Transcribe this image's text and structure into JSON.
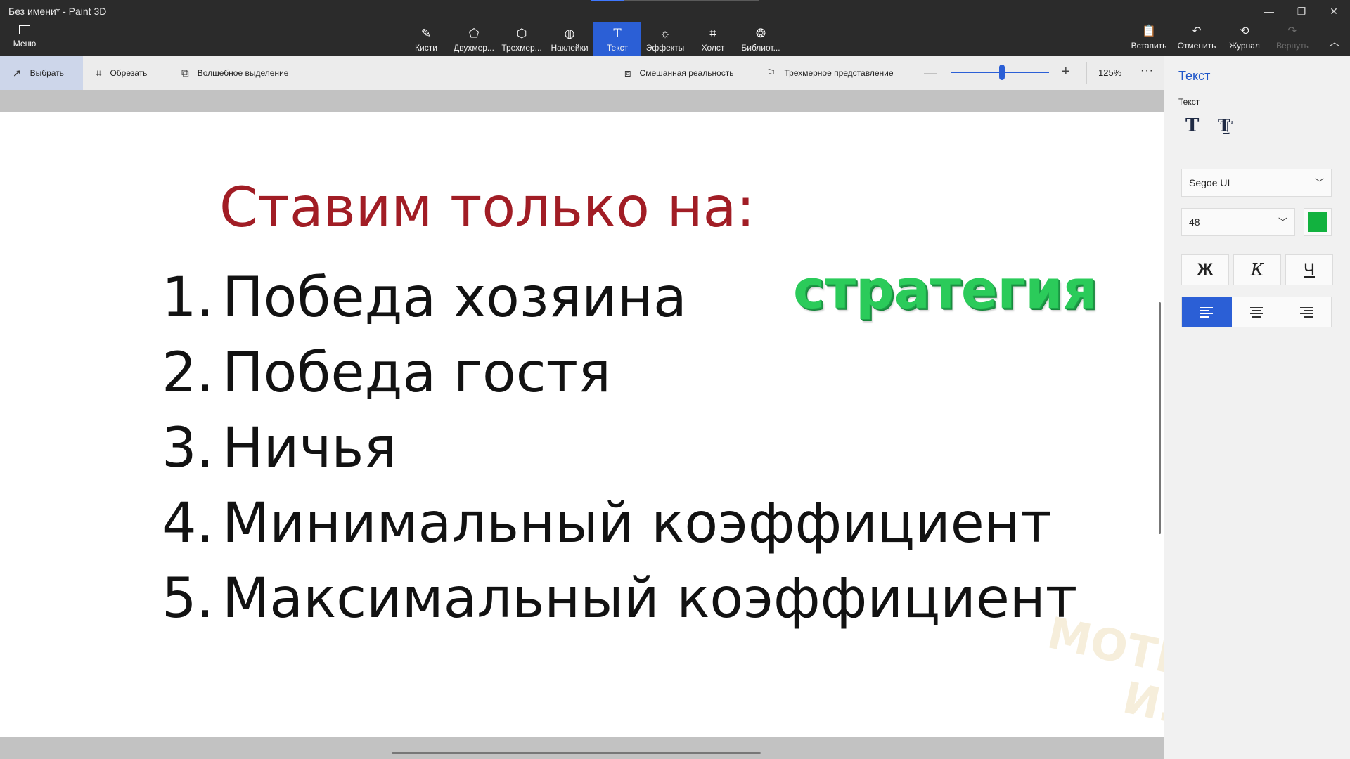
{
  "window": {
    "title": "Без имени* - Paint 3D",
    "minimize_glyph": "—",
    "restore_glyph": "❐",
    "close_glyph": "✕"
  },
  "menu": {
    "label": "Меню",
    "icon": "folder-icon"
  },
  "tools": [
    {
      "label": "Кисти",
      "icon": "brush-icon"
    },
    {
      "label": "Двухмер...",
      "icon": "2d-shapes-icon"
    },
    {
      "label": "Трехмер...",
      "icon": "3d-shapes-icon"
    },
    {
      "label": "Наклейки",
      "icon": "stickers-icon"
    },
    {
      "label": "Текст",
      "icon": "text-icon",
      "active": true
    },
    {
      "label": "Эффекты",
      "icon": "effects-icon"
    },
    {
      "label": "Холст",
      "icon": "canvas-icon"
    },
    {
      "label": "Библиот...",
      "icon": "library-icon"
    }
  ],
  "actions": {
    "paste": "Вставить",
    "undo": "Отменить",
    "history": "Журнал",
    "redo": "Вернуть"
  },
  "subtoolbar": {
    "select": "Выбрать",
    "crop": "Обрезать",
    "magic_select": "Волшебное выделение",
    "mixed_reality": "Смешанная реальность",
    "view_3d": "Трехмерное представление",
    "zoom_minus": "—",
    "zoom_plus": "+",
    "zoom_level": "125%",
    "zoom_fraction": 0.52,
    "more": "···"
  },
  "canvas": {
    "title": "Ставим только на:",
    "list": [
      {
        "num": "1.",
        "text": "Победа хозяина"
      },
      {
        "num": "2.",
        "text": "Победа гостя"
      },
      {
        "num": "3.",
        "text": "Ничья"
      },
      {
        "num": "4.",
        "text": "Минимальный коэффициент"
      },
      {
        "num": "5.",
        "text": "Максимальный коэффициент"
      }
    ],
    "highlight_word": "стратегия",
    "watermark_line1": "МОТЫКИН",
    "watermark_line2": "И.И"
  },
  "panel": {
    "title": "Текст",
    "section_label": "Текст",
    "font_family": "Segoe UI",
    "font_size": "48",
    "text_color": "#12b23f",
    "bold_glyph": "Ж",
    "italic_glyph": "К",
    "underline_glyph": "Ч",
    "align_active": "left"
  }
}
